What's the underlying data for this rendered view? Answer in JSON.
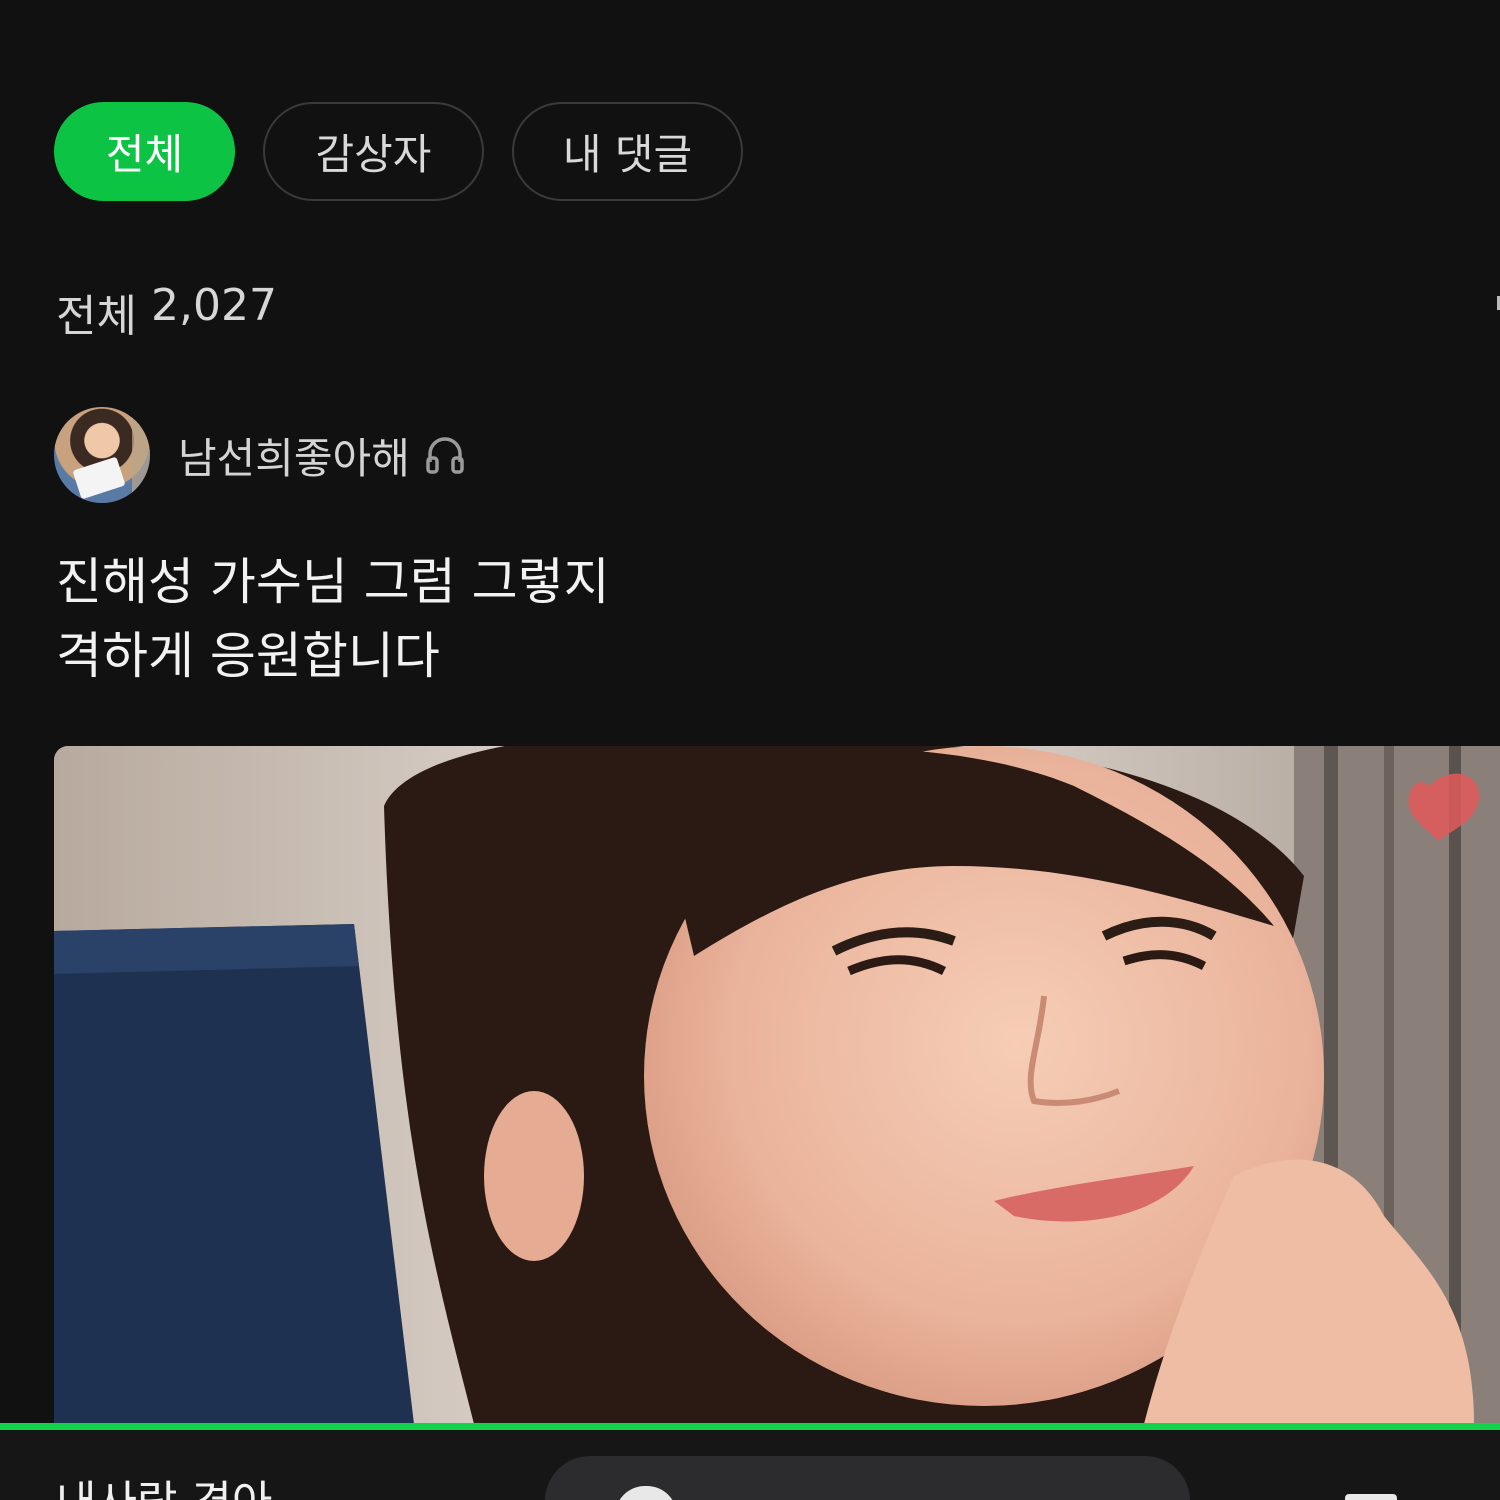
{
  "tabs": [
    {
      "label": "전체",
      "active": true
    },
    {
      "label": "감상자",
      "active": false
    },
    {
      "label": "내 댓글",
      "active": false
    }
  ],
  "summary": {
    "label": "전체",
    "count": "2,027"
  },
  "comment": {
    "username": "남선희좋아해",
    "badge_icon": "headphone-icon",
    "text_lines": [
      "진해성 가수님 그럼 그렇지",
      "격하게 응원합니다"
    ]
  },
  "player": {
    "title": "내사랑 경아"
  },
  "colors": {
    "accent": "#0dc344",
    "background": "#111112",
    "progress": "#11d44a"
  }
}
